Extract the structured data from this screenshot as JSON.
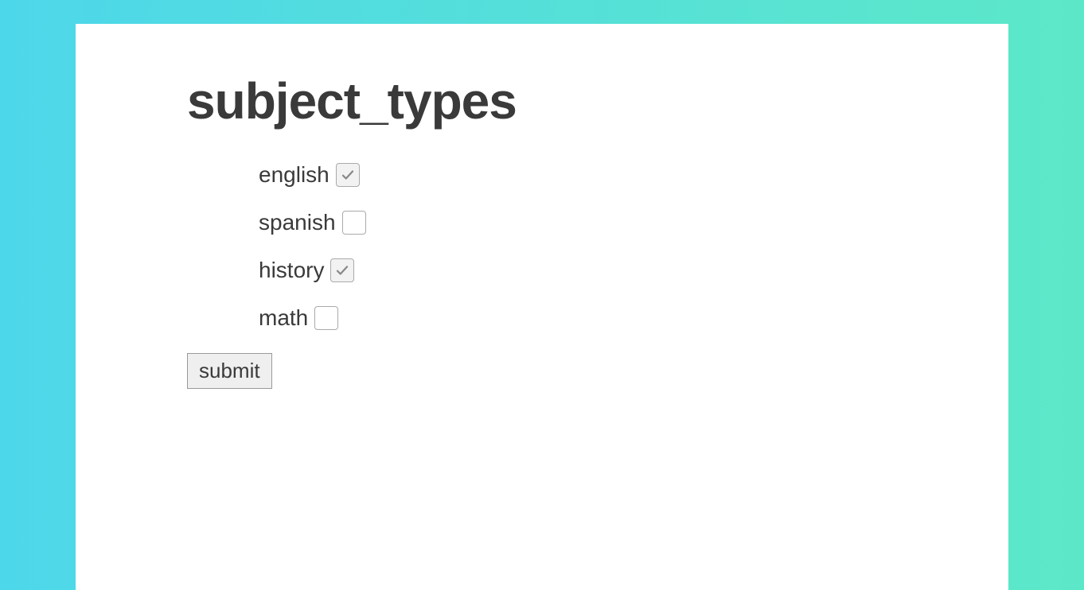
{
  "heading": "subject_types",
  "options": [
    {
      "label": "english",
      "checked": true
    },
    {
      "label": "spanish",
      "checked": false
    },
    {
      "label": "history",
      "checked": true
    },
    {
      "label": "math",
      "checked": false
    }
  ],
  "submit_label": "submit"
}
